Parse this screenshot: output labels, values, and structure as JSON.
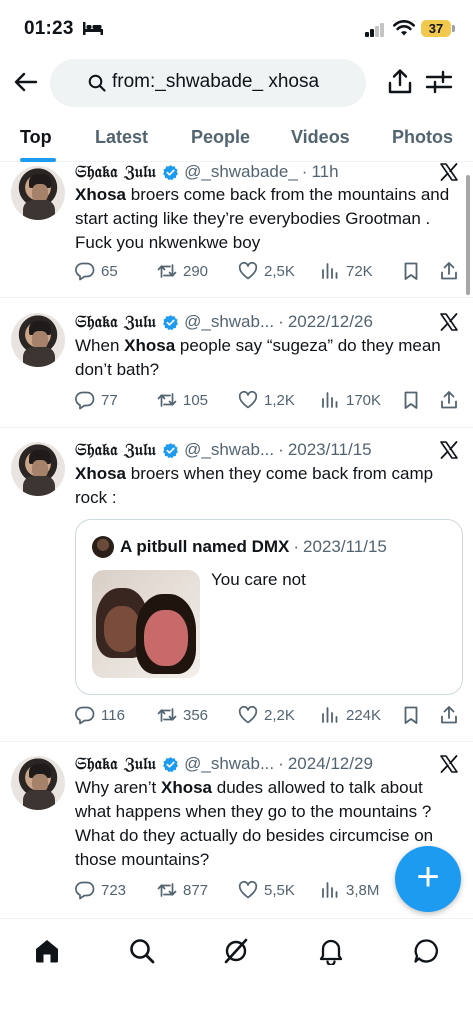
{
  "status_bar": {
    "time": "01:23",
    "battery": "37"
  },
  "search": {
    "query": "from:_shwabade_ xhosa"
  },
  "tabs": [
    {
      "label": "Top",
      "active": true
    },
    {
      "label": "Latest",
      "active": false
    },
    {
      "label": "People",
      "active": false
    },
    {
      "label": "Videos",
      "active": false
    },
    {
      "label": "Photos",
      "active": false
    }
  ],
  "tweets": [
    {
      "name": "𝔖𝔥𝔞𝔨𝔞 ℨ𝔲𝔩𝔲",
      "handle": "@_shwabade_",
      "date": "11h",
      "text_bold": "Xhosa",
      "text_rest": " broers come back from the mountains and start acting like they’re everybodies Grootman . Fuck you nkwenkwe boy",
      "replies": "65",
      "reposts": "290",
      "likes": "2,5K",
      "views": "72K"
    },
    {
      "name": "𝔖𝔥𝔞𝔨𝔞 ℨ𝔲𝔩𝔲",
      "handle": "@_shwab...",
      "date": "2022/12/26",
      "text_pre": "When ",
      "text_bold": "Xhosa",
      "text_rest": " people say “sugeza” do they mean don’t bath?",
      "replies": "77",
      "reposts": "105",
      "likes": "1,2K",
      "views": "170K"
    },
    {
      "name": "𝔖𝔥𝔞𝔨𝔞 ℨ𝔲𝔩𝔲",
      "handle": "@_shwab...",
      "date": "2023/11/15",
      "text_bold": "Xhosa",
      "text_rest": " broers when they come back from camp rock :",
      "quote": {
        "name": "A pitbull named DMX",
        "date": "2023/11/15",
        "text": "You care not"
      },
      "replies": "116",
      "reposts": "356",
      "likes": "2,2K",
      "views": "224K"
    },
    {
      "name": "𝔖𝔥𝔞𝔨𝔞 ℨ𝔲𝔩𝔲",
      "handle": "@_shwab...",
      "date": "2024/12/29",
      "text_pre": "Why aren’t ",
      "text_bold": "Xhosa",
      "text_rest": " dudes allowed to talk about what happens when they go to the mountains ? What do they actually do besides circumcise on those mountains?",
      "replies": "723",
      "reposts": "877",
      "likes": "5,5K",
      "views": "3,8M"
    }
  ],
  "fab_label": "+",
  "colors": {
    "accent": "#1d9bf0",
    "secondary_text": "#536471",
    "verified": "#1d9bf0"
  },
  "bottom_nav": [
    "home-icon",
    "search-icon",
    "grok-icon",
    "notifications-icon",
    "messages-icon"
  ]
}
